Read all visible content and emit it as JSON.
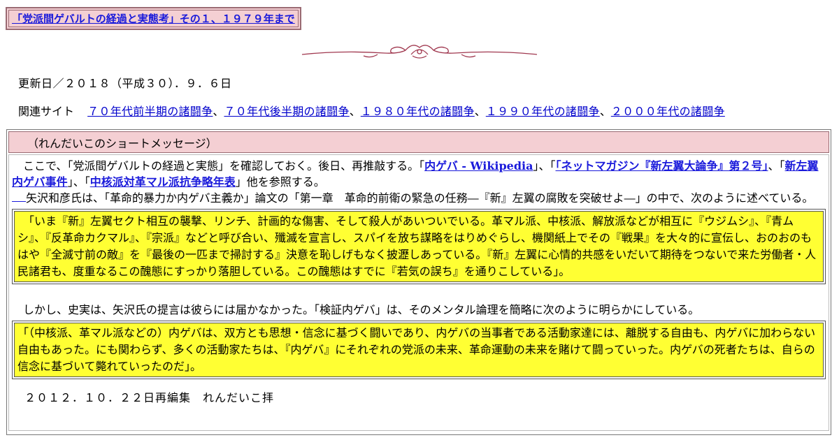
{
  "title": "「党派間ゲバルトの経過と実態考」その１、１９７９年まで",
  "updated": "更新日／２０１８（平成３０）．９．６日",
  "related": {
    "label": "関連サイト",
    "links": [
      "７０年代前半期の諸闘争",
      "７０年代後半期の諸闘争",
      "１９８０年代の諸闘争",
      "１９９０年代の諸闘争",
      "２０００年代の諸闘争"
    ],
    "separator": "、"
  },
  "message_header": "（れんだいこのショートメッセージ）",
  "intro": {
    "text1": "ここで、「党派間ゲバルトの経過と実態」を確認しておく。後日、再推敲する。「",
    "link1": "内ゲバ - Wikipedia",
    "text2": "」、「",
    "link2": "「ネットマガジン『新左翼大論争』第２号」",
    "text3": "、「",
    "link3": "新左翼内ゲバ事件",
    "text4": "」、「",
    "link4": "中核派対革マル派抗争略年表",
    "text5": "」他を参照する。",
    "yazawa": "矢沢和彦氏は、「革命的暴力か内ゲバ主義か」論文の「第一章　革命的前衛の緊急の任務―『新』左翼の腐敗を突破せよ―」の中で、次のように述べている。"
  },
  "quote1": "「いま『新』左翼セクト相互の襲撃、リンチ、計画的な傷害、そして殺人があいついでいる。革マル派、中核派、解放派などが相互に『ウジムシ』、『青ムシ』、『反革命カクマル』、『宗派』などと呼び合い、殲滅を宣言し、スパイを放ち謀略をはりめぐらし、機関紙上でその『戦果』を大々的に宣伝し、おのおのもはや『全滅寸前の敵』を『最後の一匹まで掃討する』決意を恥しげもなく披瀝しあっている。『新』左翼に心情的共感をいだいて期待をつないで来た労働者・人民諸君も、度重なるこの醜態にすっかり落胆している。この醜態はすでに『若気の誤ち』を通りこしている」。",
  "para2": "しかし、史実は、矢沢氏の提言は彼らには届かなかった。「検証内ゲバ」は、そのメンタル論理を簡略に次のように明らかにしている。",
  "quote2": "「（中核派、革マル派などの）内ゲバは、双方とも思想・信念に基づく闘いであり、内ゲバの当事者である活動家達には、離脱する自由も、内ゲバに加わらない自由もあった。にも関わらず、多くの活動家たちは、『内ゲバ』にそれぞれの党派の未来、革命運動の未来を賭けて闘っていった。内ゲバの死者たちは、自らの信念に基づいて斃れていったのだ」。",
  "signoff": "２０１２．１０．２２日再編集　れんだいこ拝",
  "colors": {
    "pink": "#f4cfd3",
    "yellow": "#ffff33",
    "link": "#0000cc",
    "ornament": "#a0384f"
  }
}
